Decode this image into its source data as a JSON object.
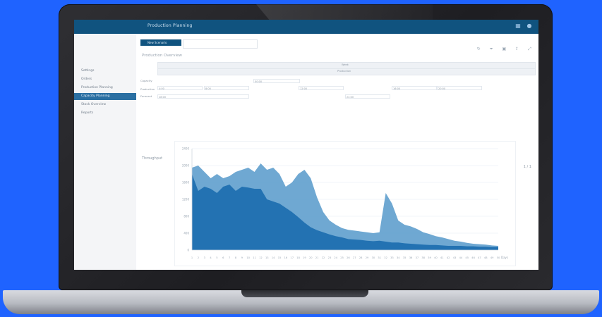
{
  "app": {
    "title": "Production Planning"
  },
  "sidebar": {
    "items": [
      {
        "label": "Settings"
      },
      {
        "label": "Orders"
      },
      {
        "label": "Production Planning"
      },
      {
        "label": "Capacity Planning"
      },
      {
        "label": "Stock Overview"
      },
      {
        "label": "Reports"
      }
    ]
  },
  "toolbar": {
    "primary_button": "New Scenario",
    "search_placeholder": ""
  },
  "main": {
    "section_title": "Production Overview"
  },
  "filter_table": {
    "header_1": "Week",
    "header_2": "Production",
    "rows": [
      {
        "label": "Capacity"
      },
      {
        "label": "Production"
      },
      {
        "label": "Forecast"
      }
    ],
    "cells": [
      "00:00",
      "4:00",
      "8:00",
      "12:00",
      "16:00",
      "20:00",
      "24:00",
      "28:00"
    ]
  },
  "chart_section": {
    "label": "Throughput",
    "side_tag": "1 / 1"
  },
  "chart_data": {
    "type": "area",
    "x": [
      "1",
      "2",
      "3",
      "4",
      "5",
      "6",
      "7",
      "8",
      "9",
      "10",
      "11",
      "12",
      "13",
      "14",
      "15",
      "16",
      "17",
      "18",
      "19",
      "20",
      "21",
      "22",
      "23",
      "24",
      "25",
      "26",
      "27",
      "28",
      "29",
      "30",
      "31",
      "32",
      "33",
      "34",
      "35",
      "36",
      "37",
      "38",
      "39",
      "40",
      "41",
      "42",
      "43",
      "44",
      "45",
      "46",
      "47",
      "48",
      "49",
      "50"
    ],
    "series": [
      {
        "values": [
          1800,
          1400,
          1500,
          1450,
          1350,
          1500,
          1550,
          1400,
          1500,
          1480,
          1450,
          1450,
          1200,
          1150,
          1100,
          1000,
          900,
          780,
          650,
          540,
          470,
          420,
          370,
          330,
          300,
          260,
          250,
          240,
          220,
          210,
          220,
          200,
          180,
          180,
          160,
          150,
          140,
          130,
          120,
          120,
          110,
          100,
          100,
          100,
          90,
          90,
          80,
          80,
          70,
          70
        ],
        "color": "#1f6fb0"
      },
      {
        "values": [
          1950,
          2000,
          1850,
          1700,
          1800,
          1700,
          1750,
          1850,
          1900,
          1950,
          1850,
          2050,
          1900,
          1950,
          1800,
          1500,
          1600,
          1800,
          1900,
          1700,
          1250,
          900,
          700,
          600,
          520,
          480,
          460,
          440,
          420,
          400,
          420,
          1350,
          1100,
          700,
          600,
          560,
          500,
          420,
          380,
          330,
          300,
          260,
          220,
          200,
          170,
          150,
          140,
          130,
          110,
          100
        ],
        "color": "#5f9fcd"
      }
    ],
    "ylim": [
      0,
      2400
    ],
    "yticks": [
      "0",
      "400",
      "800",
      "1200",
      "1600",
      "2000",
      "2400"
    ],
    "x_unit": "Days",
    "grid": true,
    "legend": false
  }
}
